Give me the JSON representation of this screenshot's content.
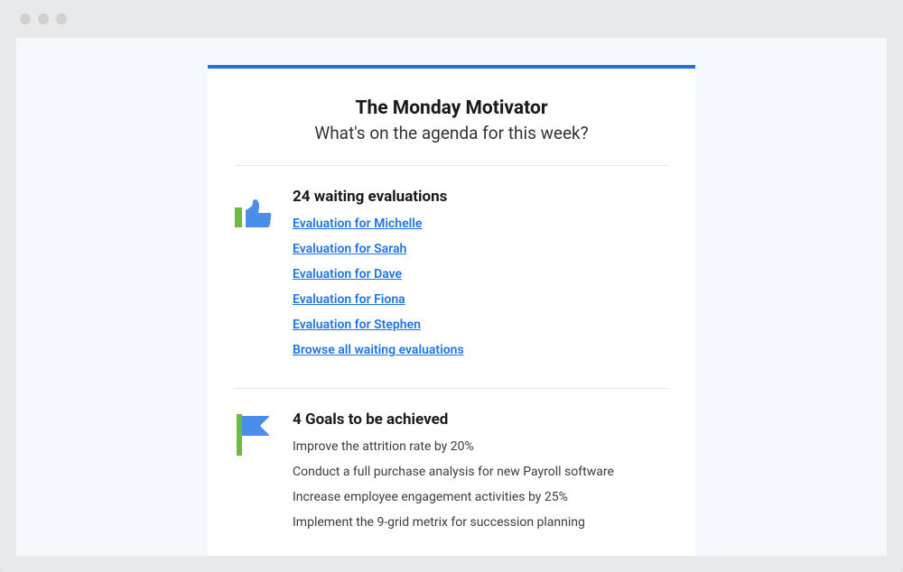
{
  "header": {
    "title": "The Monday Motivator",
    "subtitle": "What's on the agenda for this week?"
  },
  "evaluations": {
    "heading": "24 waiting evaluations",
    "items": [
      "Evaluation for Michelle",
      "Evaluation for Sarah",
      "Evaluation for Dave",
      "Evaluation for Fiona",
      "Evaluation for Stephen"
    ],
    "browse_all": "Browse all waiting evaluations"
  },
  "goals": {
    "heading": "4 Goals to be achieved",
    "items": [
      "Improve the attrition rate by 20%",
      "Conduct a full purchase analysis for new Payroll software",
      "Increase employee engagement activities by 25%",
      "Implement the 9-grid metrix for succession planning"
    ]
  },
  "colors": {
    "accent_blue": "#1e74e6",
    "icon_blue": "#4a8eea",
    "icon_green": "#6dbb45"
  }
}
